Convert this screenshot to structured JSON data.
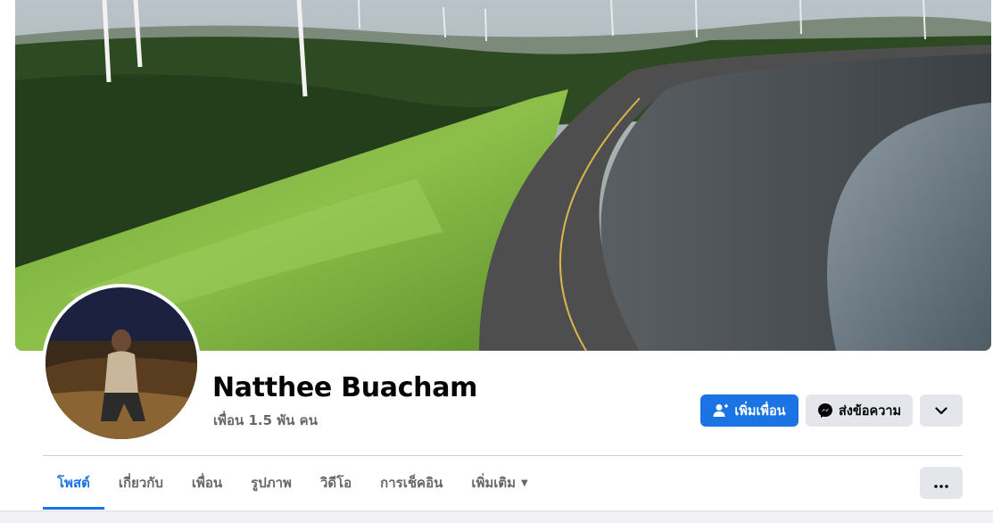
{
  "profile": {
    "name": "Natthee Buacham",
    "friends": "เพื่อน 1.5 พัน คน"
  },
  "actions": {
    "add_friend": "เพิ่มเพื่อน",
    "message": "ส่งข้อความ"
  },
  "tabs": [
    {
      "label": "โพสต์",
      "active": true
    },
    {
      "label": "เกี่ยวกับ",
      "active": false
    },
    {
      "label": "เพื่อน",
      "active": false
    },
    {
      "label": "รูปภาพ",
      "active": false
    },
    {
      "label": "วิดีโอ",
      "active": false
    },
    {
      "label": "การเช็คอิน",
      "active": false
    },
    {
      "label": "เพิ่มเติม",
      "active": false
    }
  ],
  "icons": {
    "add_friend": "add-person-icon",
    "message": "messenger-icon",
    "expand": "chevron-down-icon",
    "tab_more_caret": "caret-down-icon",
    "tabs_more": "more-horizontal-icon"
  },
  "colors": {
    "accent": "#1b74e4",
    "secondary_button": "#e4e6eb",
    "muted_text": "#65676b"
  }
}
